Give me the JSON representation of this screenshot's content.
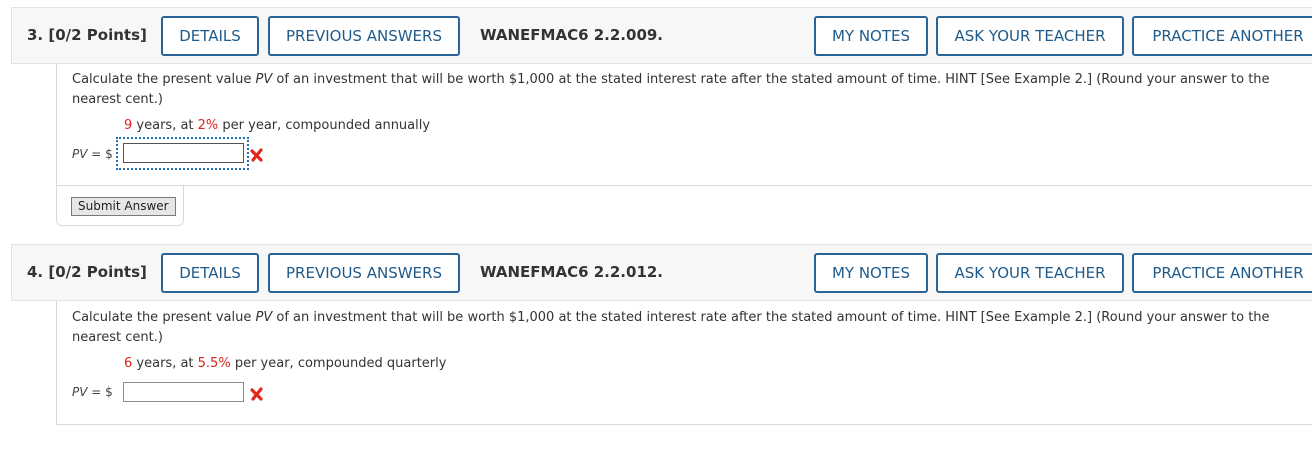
{
  "questions": [
    {
      "number_label": "3. [0/2 Points]",
      "details_label": "DETAILS",
      "previous_answers_label": "PREVIOUS ANSWERS",
      "code": "WANEFMAC6 2.2.009.",
      "my_notes_label": "MY NOTES",
      "ask_teacher_label": "ASK YOUR TEACHER",
      "practice_another_label": "PRACTICE ANOTHER",
      "prompt_before_pv": "Calculate the present value ",
      "pv_symbol": "PV",
      "prompt_after_pv": " of an investment that will be worth $1,000 at the stated interest rate after the stated amount of time. HINT [See Example 2.] (Round your answer to the nearest cent.)",
      "years_value": "9",
      "years_text": " years, at ",
      "rate_value": "2%",
      "rate_text": " per year, compounded annually",
      "pv_label_symbol": "PV",
      "pv_label_suffix": " = $",
      "answer_value": "",
      "answer_status": "incorrect",
      "submit_label": "Submit Answer"
    },
    {
      "number_label": "4. [0/2 Points]",
      "details_label": "DETAILS",
      "previous_answers_label": "PREVIOUS ANSWERS",
      "code": "WANEFMAC6 2.2.012.",
      "my_notes_label": "MY NOTES",
      "ask_teacher_label": "ASK YOUR TEACHER",
      "practice_another_label": "PRACTICE ANOTHER",
      "prompt_before_pv": "Calculate the present value ",
      "pv_symbol": "PV",
      "prompt_after_pv": " of an investment that will be worth $1,000 at the stated interest rate after the stated amount of time. HINT [See Example 2.] (Round your answer to the nearest cent.)",
      "years_value": "6",
      "years_text": " years, at ",
      "rate_value": "5.5%",
      "rate_text": " per year, compounded quarterly",
      "pv_label_symbol": "PV",
      "pv_label_suffix": " = $",
      "answer_value": "",
      "answer_status": "incorrect"
    }
  ],
  "colors": {
    "accent_blue": "#2a6496",
    "highlight_red": "#d9241b",
    "header_bg": "#f7f7f7"
  }
}
